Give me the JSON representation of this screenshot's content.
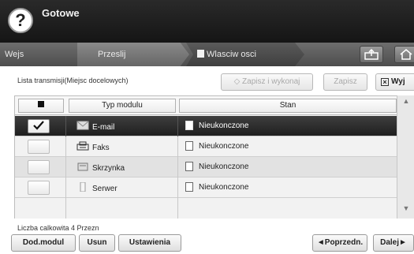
{
  "status": {
    "help_icon": "?",
    "text": "Gotowe"
  },
  "tabs": {
    "wejs": "Wejs",
    "przeslij": "Przeslij",
    "wlasciwosci": "Wlasciw osci"
  },
  "toolbar_icons": [
    "send-icon",
    "home-icon"
  ],
  "list": {
    "title": "Lista transmisji(Miejsc docelowych)",
    "save_and_run": "Zapisz i wykonaj",
    "save": "Zapisz",
    "exit": "Wyj"
  },
  "table": {
    "columns": {
      "type": "Typ modulu",
      "state": "Stan"
    },
    "rows": [
      {
        "checked": true,
        "icon": "email-icon",
        "type": "E-mail",
        "state": "Nieukonczone"
      },
      {
        "checked": false,
        "icon": "fax-icon",
        "type": "Faks",
        "state": "Nieukonczone"
      },
      {
        "checked": false,
        "icon": "mailbox-icon",
        "type": "Skrzynka",
        "state": "Nieukonczone"
      },
      {
        "checked": false,
        "icon": "server-icon",
        "type": "Serwer",
        "state": "Nieukonczone"
      }
    ]
  },
  "total": "Liczba calkowita 4 Przezn",
  "buttons": {
    "add": "Dod.modul",
    "delete": "Usun",
    "settings": "Ustawienia",
    "prev": "◄Poprzedn.",
    "next": "Dalej►"
  },
  "colors": {
    "selected_row": "#2a2a2a",
    "topbar": "#1c1c1c"
  }
}
